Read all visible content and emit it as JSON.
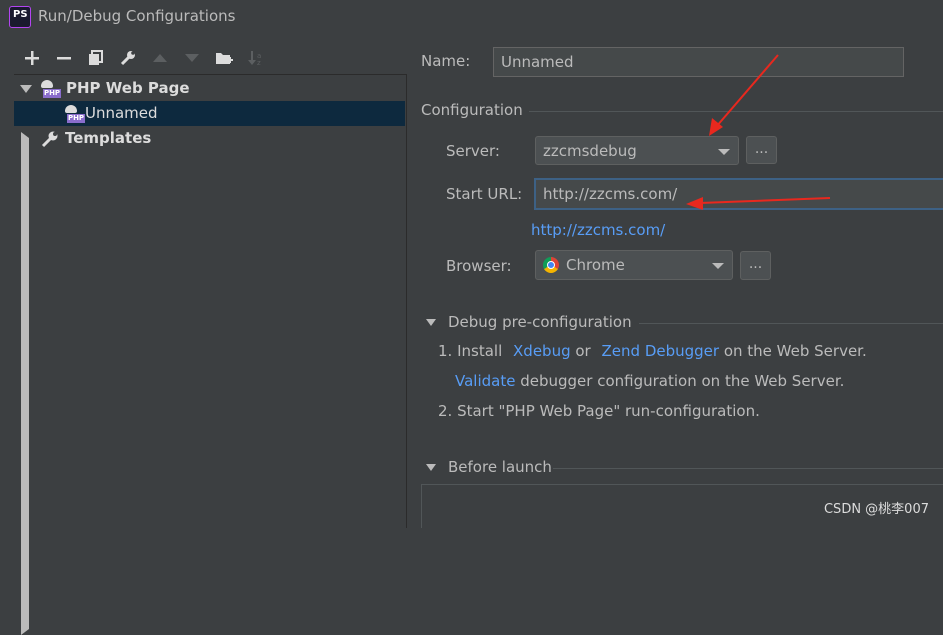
{
  "window": {
    "title": "Run/Debug Configurations",
    "app_icon_text": "PS"
  },
  "toolbar": {
    "buttons": [
      "add-icon",
      "remove-icon",
      "copy-icon",
      "wrench-icon",
      "move-up-icon",
      "move-down-icon",
      "new-folder-icon",
      "sort-icon"
    ]
  },
  "tree": {
    "items": [
      {
        "label": "PHP Web Page",
        "expanded": true
      },
      {
        "label": "Unnamed",
        "selected": true
      },
      {
        "label": "Templates",
        "expanded": false
      }
    ]
  },
  "form": {
    "name_label": "Name:",
    "name_value": "Unnamed",
    "configuration_header": "Configuration",
    "server_label": "Server:",
    "server_value": "zzcmsdebug",
    "ellipsis": "...",
    "start_url_label": "Start URL:",
    "start_url_value": "http://zzcms.com/",
    "url_preview": "http://zzcms.com/",
    "browser_label": "Browser:",
    "browser_value": "Chrome"
  },
  "debug_pre": {
    "header": "Debug pre-configuration",
    "step1_prefix": "1. Install",
    "xdebug": "Xdebug",
    "or": "or",
    "zend": "Zend Debugger",
    "step1_suffix": "on the Web Server.",
    "validate": "Validate",
    "validate_suffix": "debugger configuration on the Web Server.",
    "step2": "2. Start \"PHP Web Page\" run-configuration."
  },
  "before_launch": {
    "header": "Before launch"
  },
  "watermark": "CSDN @桃李007",
  "colors": {
    "background": "#3c3f41",
    "link": "#589df6",
    "selection": "#0d293e",
    "annotation_arrow": "#e8281e"
  }
}
